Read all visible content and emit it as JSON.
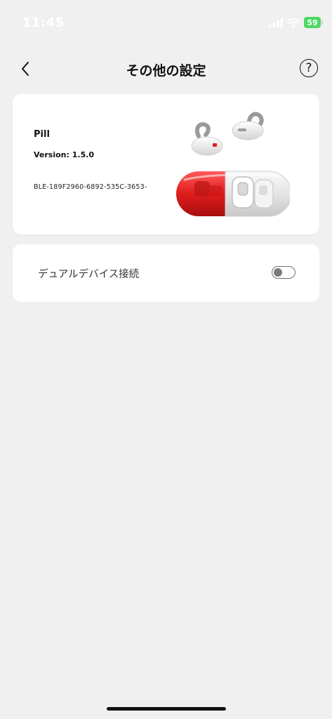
{
  "status_bar": {
    "time": "11:45",
    "battery": "59",
    "signal_icon": "signal-bars-icon",
    "wifi_icon": "wifi-icon"
  },
  "nav": {
    "title": "その他の設定",
    "back_icon": "chevron-left-icon",
    "help_label": "?"
  },
  "device": {
    "name": "Pill",
    "version": "Version: 1.5.0",
    "id": "BLE-189F2960-6892-535C-3653-",
    "image_icon": "earbuds-case-image"
  },
  "dual_device": {
    "label": "デュアルデバイス接続",
    "enabled": false
  },
  "colors": {
    "background": "#f0f0f0",
    "card": "#ffffff",
    "battery_green": "#4cd964",
    "case_red": "#e02020"
  }
}
